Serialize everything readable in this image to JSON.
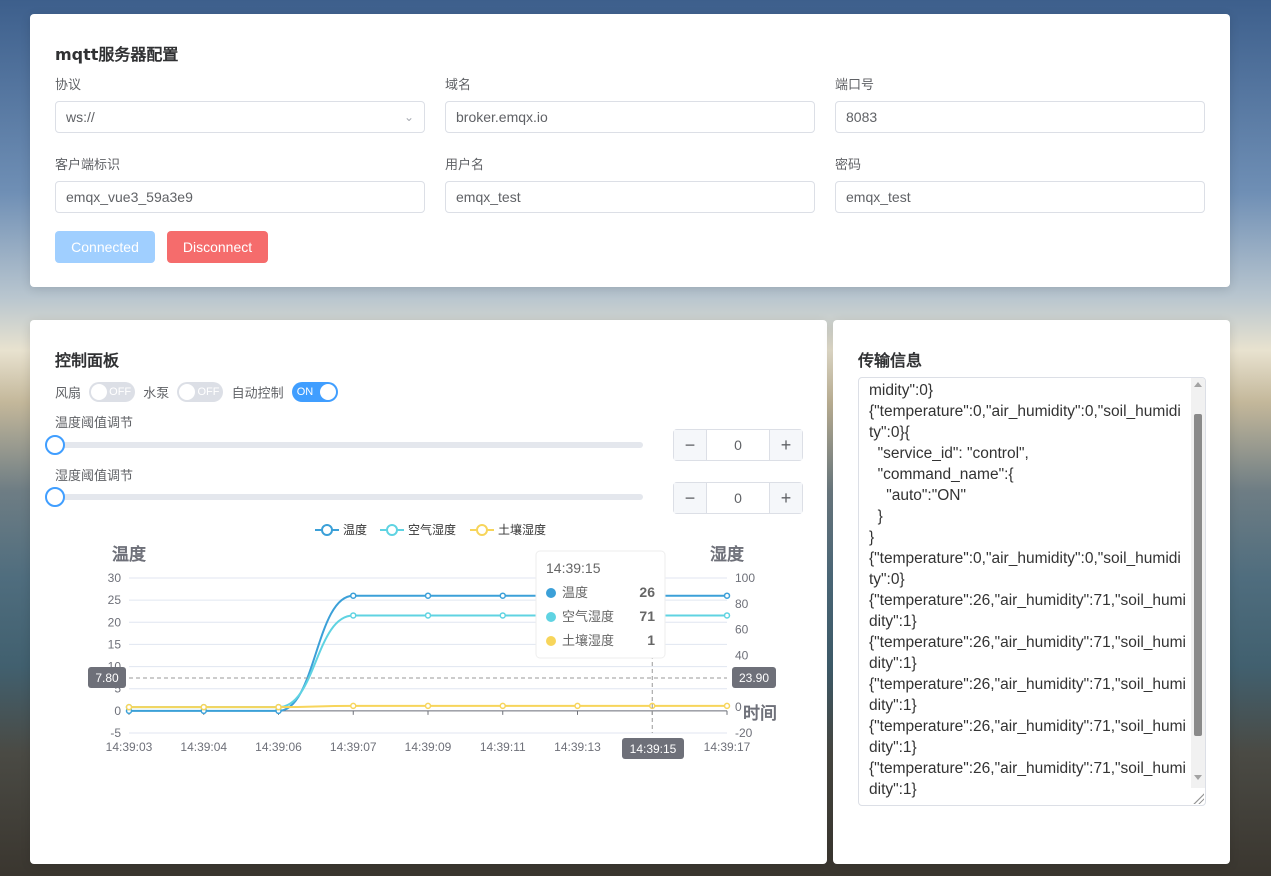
{
  "config": {
    "title": "mqtt服务器配置",
    "protocol_label": "协议",
    "protocol_value": "ws://",
    "host_label": "域名",
    "host_value": "broker.emqx.io",
    "port_label": "端口号",
    "port_value": "8083",
    "client_label": "客户端标识",
    "client_value": "emqx_vue3_59a3e9",
    "user_label": "用户名",
    "user_value": "emqx_test",
    "pass_label": "密码",
    "pass_value": "emqx_test",
    "connected_btn": "Connected",
    "disconnect_btn": "Disconnect"
  },
  "control": {
    "title": "控制面板",
    "fan_label": "风扇",
    "fan_state": "OFF",
    "pump_label": "水泵",
    "pump_state": "OFF",
    "auto_label": "自动控制",
    "auto_state": "ON",
    "temp_threshold_label": "温度阈值调节",
    "temp_threshold_value": "0",
    "hum_threshold_label": "湿度阈值调节",
    "hum_threshold_value": "0",
    "minus": "−",
    "plus": "+"
  },
  "chart_data": {
    "type": "line",
    "x": [
      "14:39:03",
      "14:39:04",
      "14:39:06",
      "14:39:07",
      "14:39:09",
      "14:39:11",
      "14:39:13",
      "14:39:15",
      "14:39:17"
    ],
    "series": [
      {
        "name": "温度",
        "axis": "left",
        "color": "#3ba0d8",
        "values": [
          0,
          0,
          0,
          26,
          26,
          26,
          26,
          26,
          26
        ]
      },
      {
        "name": "空气湿度",
        "axis": "right",
        "color": "#5fd3e2",
        "values": [
          0,
          0,
          0,
          71,
          71,
          71,
          71,
          71,
          71
        ]
      },
      {
        "name": "土壤湿度",
        "axis": "right",
        "color": "#f7d55b",
        "values": [
          0,
          0,
          0,
          1,
          1,
          1,
          1,
          1,
          1
        ]
      }
    ],
    "ylabel_left": "温度",
    "ylabel_right": "湿度",
    "xlabel": "时间",
    "ylim_left": [
      -5,
      30
    ],
    "yticks_left": [
      "30",
      "25",
      "20",
      "15",
      "10",
      "5",
      "0",
      "-5"
    ],
    "ylim_right": [
      -20,
      100
    ],
    "yticks_right": [
      "100",
      "80",
      "60",
      "40",
      "20",
      "0",
      "-20"
    ],
    "crosshair": {
      "left_value": "7.80",
      "right_value": "23.90",
      "x_value": "14:39:15"
    },
    "tooltip": {
      "time": "14:39:15",
      "rows": [
        {
          "name": "温度",
          "value": "26",
          "color": "#3ba0d8"
        },
        {
          "name": "空气湿度",
          "value": "71",
          "color": "#5fd3e2"
        },
        {
          "name": "土壤湿度",
          "value": "1",
          "color": "#f7d55b"
        }
      ]
    },
    "grid": true,
    "legend_position": "top-center"
  },
  "log": {
    "title": "传输信息",
    "text": "midity\":0}\n{\"temperature\":0,\"air_humidity\":0,\"soil_humidi\nty\":0}{\n  \"service_id\": \"control\",\n  \"command_name\":{\n    \"auto\":\"ON\"\n  }\n}\n{\"temperature\":0,\"air_humidity\":0,\"soil_humidi\nty\":0}\n{\"temperature\":26,\"air_humidity\":71,\"soil_humi\ndity\":1}\n{\"temperature\":26,\"air_humidity\":71,\"soil_humi\ndity\":1}\n{\"temperature\":26,\"air_humidity\":71,\"soil_humi\ndity\":1}\n{\"temperature\":26,\"air_humidity\":71,\"soil_humi\ndity\":1}\n{\"temperature\":26,\"air_humidity\":71,\"soil_humi\ndity\":1}"
  },
  "colors": {
    "primary": "#409eff",
    "connected": "#a0cfff",
    "danger": "#f56c6c"
  }
}
